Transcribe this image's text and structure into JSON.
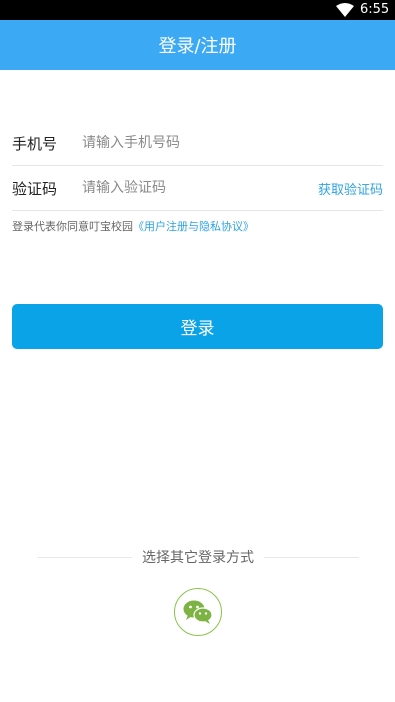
{
  "status_bar": {
    "time": "6:55",
    "wifi_icon": "wifi-icon"
  },
  "header": {
    "title": "登录/注册"
  },
  "form": {
    "phone": {
      "label": "手机号",
      "placeholder": "请输入手机号码",
      "value": ""
    },
    "code": {
      "label": "验证码",
      "placeholder": "请输入验证码",
      "value": "",
      "get_code_label": "获取验证码"
    }
  },
  "agreement": {
    "text": "登录代表你同意叮宝校园",
    "link": "《用户注册与隐私协议》"
  },
  "login_button": {
    "label": "登录"
  },
  "other_login": {
    "label": "选择其它登录方式",
    "wechat_icon": "wechat-icon"
  },
  "colors": {
    "primary": "#3ca9f4",
    "button": "#0aa3e8",
    "link": "#2ea3e0",
    "wechat": "#8bc34a"
  }
}
